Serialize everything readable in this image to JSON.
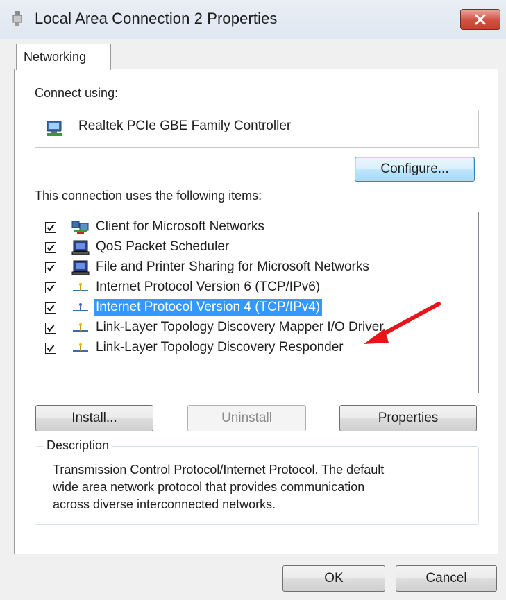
{
  "window": {
    "title": "Local Area Connection 2 Properties"
  },
  "tabs": [
    {
      "label": "Networking"
    }
  ],
  "connect_using": {
    "label": "Connect using:",
    "adapter_name": "Realtek PCIe GBE Family Controller",
    "configure_label": "Configure..."
  },
  "items_section": {
    "label": "This connection uses the following items:",
    "items": [
      {
        "label": "Client for Microsoft Networks",
        "checked": true,
        "icon": "network-client-icon",
        "selected": false
      },
      {
        "label": "QoS Packet Scheduler",
        "checked": true,
        "icon": "computer-service-icon",
        "selected": false
      },
      {
        "label": "File and Printer Sharing for Microsoft Networks",
        "checked": true,
        "icon": "computer-service-icon",
        "selected": false
      },
      {
        "label": "Internet Protocol Version 6 (TCP/IPv6)",
        "checked": true,
        "icon": "protocol-icon",
        "selected": false
      },
      {
        "label": "Internet Protocol Version 4 (TCP/IPv4)",
        "checked": true,
        "icon": "protocol-icon",
        "selected": true
      },
      {
        "label": "Link-Layer Topology Discovery Mapper I/O Driver",
        "checked": true,
        "icon": "protocol-icon",
        "selected": false
      },
      {
        "label": "Link-Layer Topology Discovery Responder",
        "checked": true,
        "icon": "protocol-icon",
        "selected": false
      }
    ]
  },
  "buttons": {
    "install": "Install...",
    "uninstall": "Uninstall",
    "properties": "Properties",
    "ok": "OK",
    "cancel": "Cancel"
  },
  "description": {
    "title": "Description",
    "lines": [
      "Transmission Control Protocol/Internet Protocol. The default",
      "wide area network protocol that provides communication",
      "across diverse interconnected networks."
    ]
  },
  "colors": {
    "selection": "#3399ff",
    "close_button": "#c7402f",
    "annotation_arrow": "#e8141a"
  }
}
